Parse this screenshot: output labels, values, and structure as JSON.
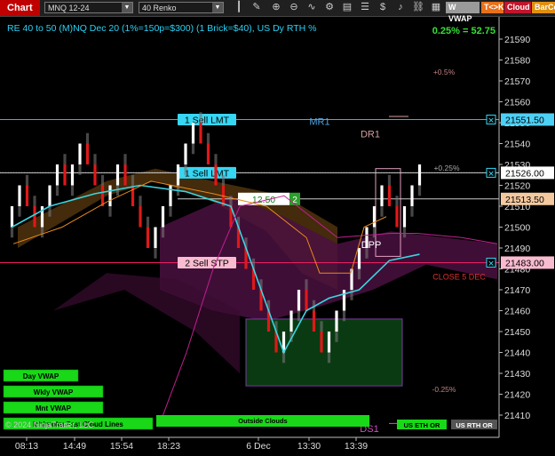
{
  "toolbar": {
    "chart_tab": "Chart",
    "instrument": "MNQ 12-24",
    "bar_type": "40 Renko",
    "buttons": [
      {
        "label": "W VWAP",
        "color": "#9a9a9a"
      },
      {
        "label": "T<>K",
        "color": "#e8701a"
      },
      {
        "label": "Cloud",
        "color": "#c0162c"
      },
      {
        "label": "BarCo",
        "color": "#e09010"
      }
    ]
  },
  "chart_data": {
    "type": "renko",
    "title": "RE 40 to 50 (M)NQ Dec 20 (1%=150p=$300) (1 Brick=$40), US Dy RTH %",
    "top_right_label": "0.25% = 52.75",
    "ylim": [
      21404,
      21597
    ],
    "yticks": [
      21410,
      21420,
      21430,
      21440,
      21450,
      21460,
      21470,
      21480,
      21490,
      21500,
      21510,
      21520,
      21530,
      21540,
      21550,
      21560,
      21570,
      21580,
      21590
    ],
    "x_tick_labels": [
      "08:13",
      "14:49",
      "15:54",
      "18:23",
      "6 Dec",
      "13:30",
      "13:39"
    ],
    "brick_size": 10,
    "bricks": [
      {
        "bar": 1,
        "open": 21500,
        "close": 21510
      },
      {
        "bar": 2,
        "open": 21510,
        "close": 21520
      },
      {
        "bar": 3,
        "open": 21520,
        "close": 21510
      },
      {
        "bar": 4,
        "open": 21510,
        "close": 21500
      },
      {
        "bar": 5,
        "open": 21500,
        "close": 21510
      },
      {
        "bar": 6,
        "open": 21510,
        "close": 21520
      },
      {
        "bar": 7,
        "open": 21520,
        "close": 21530
      },
      {
        "bar": 8,
        "open": 21530,
        "close": 21520
      },
      {
        "bar": 9,
        "open": 21520,
        "close": 21530
      },
      {
        "bar": 10,
        "open": 21530,
        "close": 21540
      },
      {
        "bar": 11,
        "open": 21540,
        "close": 21530
      },
      {
        "bar": 12,
        "open": 21530,
        "close": 21520
      },
      {
        "bar": 13,
        "open": 21520,
        "close": 21510
      },
      {
        "bar": 14,
        "open": 21510,
        "close": 21520
      },
      {
        "bar": 15,
        "open": 21520,
        "close": 21530
      },
      {
        "bar": 16,
        "open": 21530,
        "close": 21520
      },
      {
        "bar": 17,
        "open": 21520,
        "close": 21510
      },
      {
        "bar": 18,
        "open": 21510,
        "close": 21500
      },
      {
        "bar": 19,
        "open": 21500,
        "close": 21490
      },
      {
        "bar": 20,
        "open": 21490,
        "close": 21500
      },
      {
        "bar": 21,
        "open": 21500,
        "close": 21510
      },
      {
        "bar": 22,
        "open": 21510,
        "close": 21520
      },
      {
        "bar": 23,
        "open": 21520,
        "close": 21530
      },
      {
        "bar": 24,
        "open": 21530,
        "close": 21540
      },
      {
        "bar": 25,
        "open": 21540,
        "close": 21550
      },
      {
        "bar": 26,
        "open": 21550,
        "close": 21540
      },
      {
        "bar": 27,
        "open": 21540,
        "close": 21530
      },
      {
        "bar": 28,
        "open": 21530,
        "close": 21520
      },
      {
        "bar": 29,
        "open": 21520,
        "close": 21510
      },
      {
        "bar": 30,
        "open": 21510,
        "close": 21500
      },
      {
        "bar": 31,
        "open": 21500,
        "close": 21490
      },
      {
        "bar": 32,
        "open": 21490,
        "close": 21480
      },
      {
        "bar": 33,
        "open": 21480,
        "close": 21470
      },
      {
        "bar": 34,
        "open": 21470,
        "close": 21460
      },
      {
        "bar": 35,
        "open": 21460,
        "close": 21450
      },
      {
        "bar": 36,
        "open": 21450,
        "close": 21440
      },
      {
        "bar": 37,
        "open": 21440,
        "close": 21450
      },
      {
        "bar": 38,
        "open": 21450,
        "close": 21460
      },
      {
        "bar": 39,
        "open": 21460,
        "close": 21470
      },
      {
        "bar": 40,
        "open": 21470,
        "close": 21460
      },
      {
        "bar": 41,
        "open": 21460,
        "close": 21450
      },
      {
        "bar": 42,
        "open": 21450,
        "close": 21440
      },
      {
        "bar": 43,
        "open": 21440,
        "close": 21450
      },
      {
        "bar": 44,
        "open": 21450,
        "close": 21460
      },
      {
        "bar": 45,
        "open": 21460,
        "close": 21470
      },
      {
        "bar": 46,
        "open": 21470,
        "close": 21480
      },
      {
        "bar": 47,
        "open": 21480,
        "close": 21490
      },
      {
        "bar": 48,
        "open": 21490,
        "close": 21500
      },
      {
        "bar": 49,
        "open": 21500,
        "close": 21510
      },
      {
        "bar": 50,
        "open": 21510,
        "close": 21520
      },
      {
        "bar": 51,
        "open": 21520,
        "close": 21510
      },
      {
        "bar": 52,
        "open": 21510,
        "close": 21500
      },
      {
        "bar": 53,
        "open": 21500,
        "close": 21510
      },
      {
        "bar": 54,
        "open": 21510,
        "close": 21520
      },
      {
        "bar": 55,
        "open": 21520,
        "close": 21530
      }
    ],
    "vwap_line": [
      {
        "bar": 1,
        "price": 21500
      },
      {
        "bar": 6,
        "price": 21510
      },
      {
        "bar": 12,
        "price": 21516
      },
      {
        "bar": 18,
        "price": 21520
      },
      {
        "bar": 24,
        "price": 21517
      },
      {
        "bar": 30,
        "price": 21510
      },
      {
        "bar": 34,
        "price": 21470
      },
      {
        "bar": 37,
        "price": 21440
      },
      {
        "bar": 40,
        "price": 21460
      },
      {
        "bar": 43,
        "price": 21466
      },
      {
        "bar": 47,
        "price": 21470
      },
      {
        "bar": 51,
        "price": 21484
      },
      {
        "bar": 55,
        "price": 21487
      }
    ],
    "levels": [
      {
        "label": "1 Sell LMT",
        "price": 21551.5,
        "color": "#29b6f6",
        "axis_label": "21551.50",
        "axis_color": "#4dd0f5"
      },
      {
        "label": "1 Sell LMT",
        "price": 21526,
        "color": "#cccccc",
        "axis_label": "21526.00",
        "axis_color": "#ffffff"
      },
      {
        "label": "12.50",
        "price": 21513.5,
        "color": "#cccccc",
        "axis_label": "21513.50",
        "axis_color": "#f5c9a0"
      },
      {
        "label": "2 Sell STP",
        "price": 21483,
        "color": "#e91e63",
        "axis_label": "21483.00",
        "axis_color": "#f8bbd0"
      }
    ],
    "position_qty": "2",
    "zone_labels": [
      {
        "label": "MR1",
        "color": "#4fa3e0"
      },
      {
        "label": "DR1",
        "color": "#d4a0a0"
      },
      {
        "label": "DPP",
        "color": "#ffffff"
      },
      {
        "label": "DS1",
        "color": "#d050c0"
      },
      {
        "label": "+0.5%",
        "color": "#c08080"
      },
      {
        "label": "+0.25%",
        "color": "#aaaaaa"
      },
      {
        "label": "-0.25%",
        "color": "#c08080"
      },
      {
        "label": "CLOSE 5 DEC",
        "color": "#e03030"
      }
    ],
    "legend_buttons": [
      "Day VWAP",
      "Wkly VWAP",
      "Mnt VWAP",
      "Ichimoku Fast Cloud Lines"
    ],
    "footer_buttons": [
      "Outside Clouds",
      "US ETH OR",
      "US RTH OR"
    ],
    "copyright": "© 2024 NinjaTrader, LLC"
  }
}
